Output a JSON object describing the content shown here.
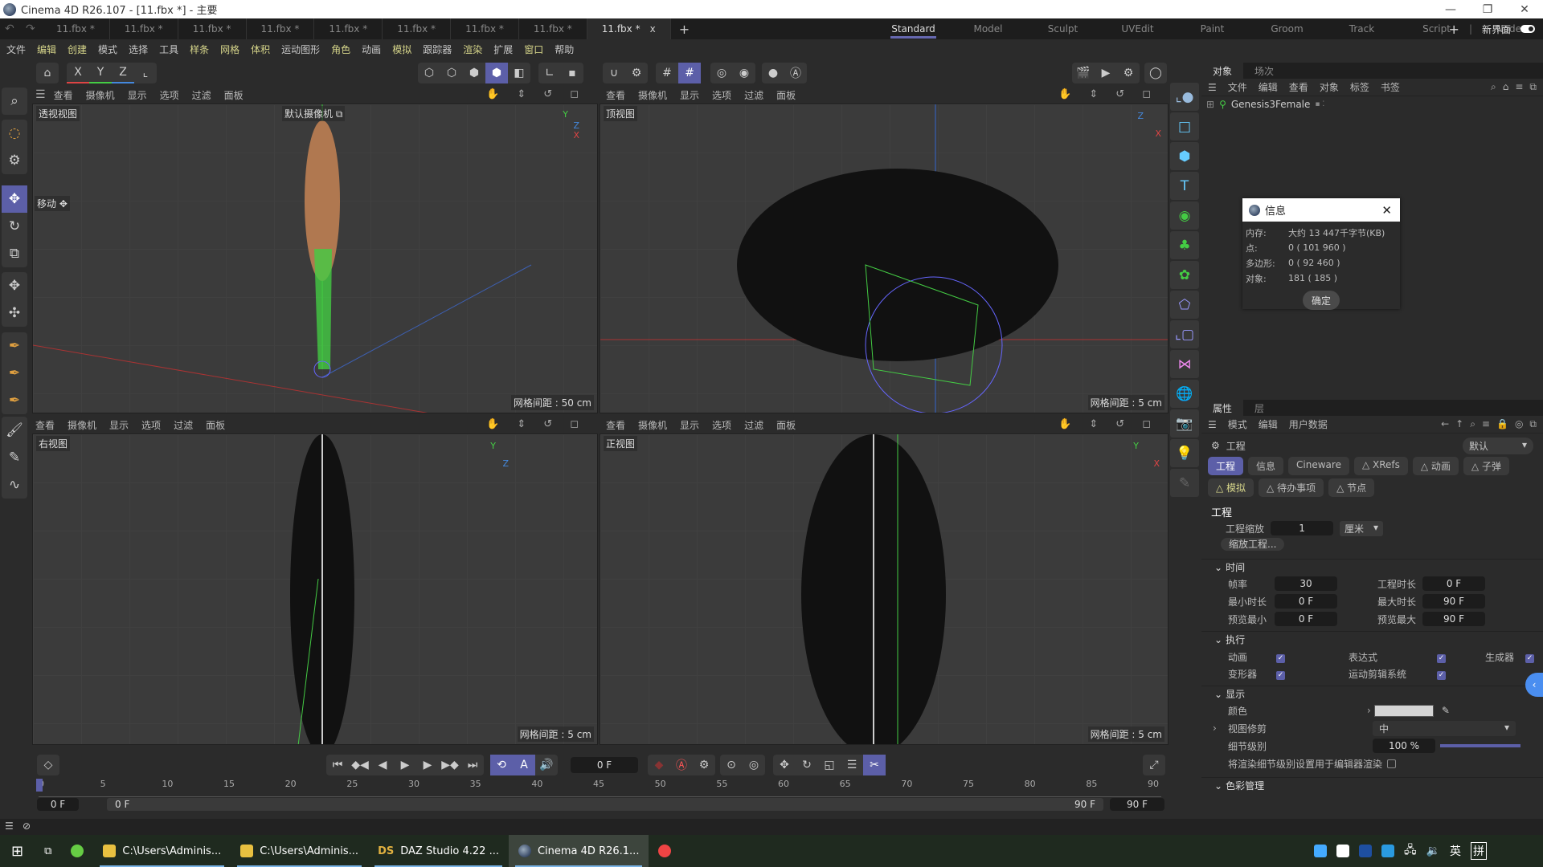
{
  "window": {
    "title": "Cinema 4D R26.107 - [11.fbx *] - 主要",
    "controls": [
      "minimize",
      "restore",
      "close"
    ]
  },
  "doc_tabs": [
    "11.fbx *",
    "11.fbx *",
    "11.fbx *",
    "11.fbx *",
    "11.fbx *",
    "11.fbx *",
    "11.fbx *",
    "11.fbx *",
    "11.fbx *",
    "11.fbx *"
  ],
  "active_tab": {
    "label": "11.fbx *",
    "close": "x"
  },
  "add_tab": "+",
  "layouts": [
    "Standard",
    "Model",
    "Sculpt",
    "UVEdit",
    "Paint",
    "Groom",
    "Track",
    "Script",
    "Nodes"
  ],
  "active_layout": "Standard",
  "new_ui_label": "新界面",
  "menus": [
    {
      "label": "文件",
      "y": false
    },
    {
      "label": "编辑",
      "y": true
    },
    {
      "label": "创建",
      "y": true
    },
    {
      "label": "模式",
      "y": false
    },
    {
      "label": "选择",
      "y": false
    },
    {
      "label": "工具",
      "y": false
    },
    {
      "label": "样条",
      "y": true
    },
    {
      "label": "网格",
      "y": true
    },
    {
      "label": "体积",
      "y": true
    },
    {
      "label": "运动图形",
      "y": false
    },
    {
      "label": "角色",
      "y": true
    },
    {
      "label": "动画",
      "y": false
    },
    {
      "label": "模拟",
      "y": true
    },
    {
      "label": "跟踪器",
      "y": false
    },
    {
      "label": "渲染",
      "y": true
    },
    {
      "label": "扩展",
      "y": false
    },
    {
      "label": "窗口",
      "y": true
    },
    {
      "label": "帮助",
      "y": false
    }
  ],
  "toolbar": {
    "axis_x": "X",
    "axis_y": "Y",
    "axis_z": "Z"
  },
  "viewport_menu": [
    "查看",
    "摄像机",
    "显示",
    "选项",
    "过滤",
    "面板"
  ],
  "viewports": [
    {
      "name": "透视视图",
      "camera": "默认摄像机",
      "grid": "网格间距 : 50 cm",
      "move_label": "移动"
    },
    {
      "name": "顶视图",
      "grid": "网格间距 : 5 cm"
    },
    {
      "name": "右视图",
      "grid": "网格间距 : 5 cm"
    },
    {
      "name": "正视图",
      "grid": "网格间距 : 5 cm"
    }
  ],
  "axes": {
    "x": "X",
    "y": "Y",
    "z": "Z"
  },
  "object_panel": {
    "tabs": [
      "对象",
      "场次"
    ],
    "menu": [
      "文件",
      "编辑",
      "查看",
      "对象",
      "标签",
      "书签"
    ],
    "objects": [
      {
        "name": "Genesis3Female"
      }
    ]
  },
  "info_dialog": {
    "title": "信息",
    "rows": [
      {
        "key": "内存:",
        "value": "大约 13 447千字节(KB)"
      },
      {
        "key": "点:",
        "value": "0 ( 101 960 )"
      },
      {
        "key": "多边形:",
        "value": "0 ( 92 460 )"
      },
      {
        "key": "对象:",
        "value": "181 ( 185 )"
      }
    ],
    "ok": "确定"
  },
  "attr_panel": {
    "tabs": [
      "属性",
      "层"
    ],
    "menu": [
      "模式",
      "编辑",
      "用户数据"
    ],
    "object": "工程",
    "preset": "默认",
    "chips": [
      {
        "label": "工程",
        "on": true
      },
      {
        "label": "信息"
      },
      {
        "label": "Cineware"
      },
      {
        "label": "△ XRefs"
      },
      {
        "label": "△ 动画"
      },
      {
        "label": "△ 子弹"
      },
      {
        "label": "△ 模拟",
        "y": true
      },
      {
        "label": "△ 待办事项"
      },
      {
        "label": "△ 节点"
      }
    ],
    "section_title": "工程",
    "scale_label": "工程缩放",
    "scale_value": "1",
    "scale_unit": "厘米",
    "scale_button": "缩放工程...",
    "time": {
      "title": "时间",
      "fps_label": "帧率",
      "fps": "30",
      "proj_len_label": "工程时长",
      "proj_len": "0 F",
      "min_label": "最小时长",
      "min": "0 F",
      "max_label": "最大时长",
      "max": "90 F",
      "pmin_label": "预览最小",
      "pmin": "0 F",
      "pmax_label": "预览最大",
      "pmax": "90 F"
    },
    "exec": {
      "title": "执行",
      "items": [
        {
          "label": "动画",
          "checked": true
        },
        {
          "label": "表达式",
          "checked": true
        },
        {
          "label": "生成器",
          "checked": true
        },
        {
          "label": "变形器",
          "checked": true
        },
        {
          "label": "运动剪辑系统",
          "checked": true
        }
      ]
    },
    "display": {
      "title": "显示",
      "color_label": "颜色",
      "color_value": "#d4d4d4",
      "clip_label": "视图修剪",
      "clip_value": "中",
      "lod_label": "细节级别",
      "lod_value": "100 %",
      "lod_fraction": 1.0,
      "render_lod_label": "将渲染细节级别设置用于编辑器渲染",
      "render_lod_checked": false
    },
    "color_mgmt": "色彩管理"
  },
  "timeline": {
    "current_frame": "0 F",
    "ticks": [
      "0",
      "5",
      "10",
      "15",
      "20",
      "25",
      "30",
      "35",
      "40",
      "45",
      "50",
      "55",
      "60",
      "65",
      "70",
      "75",
      "80",
      "85",
      "90"
    ],
    "start": "0 F",
    "range_start": "0 F",
    "range_end": "90 F",
    "end": "90 F"
  },
  "taskbar": {
    "items": [
      {
        "label": "C:\\Users\\Adminis...",
        "icon": "folder-icon"
      },
      {
        "label": "C:\\Users\\Adminis...",
        "icon": "folder-icon"
      },
      {
        "label": "DAZ Studio 4.22 ...",
        "icon": "daz-icon"
      },
      {
        "label": "Cinema 4D R26.1...",
        "icon": "c4d-icon",
        "active": true
      }
    ],
    "ime1": "英",
    "ime2": "拼"
  },
  "accent": "#5c5fa8"
}
